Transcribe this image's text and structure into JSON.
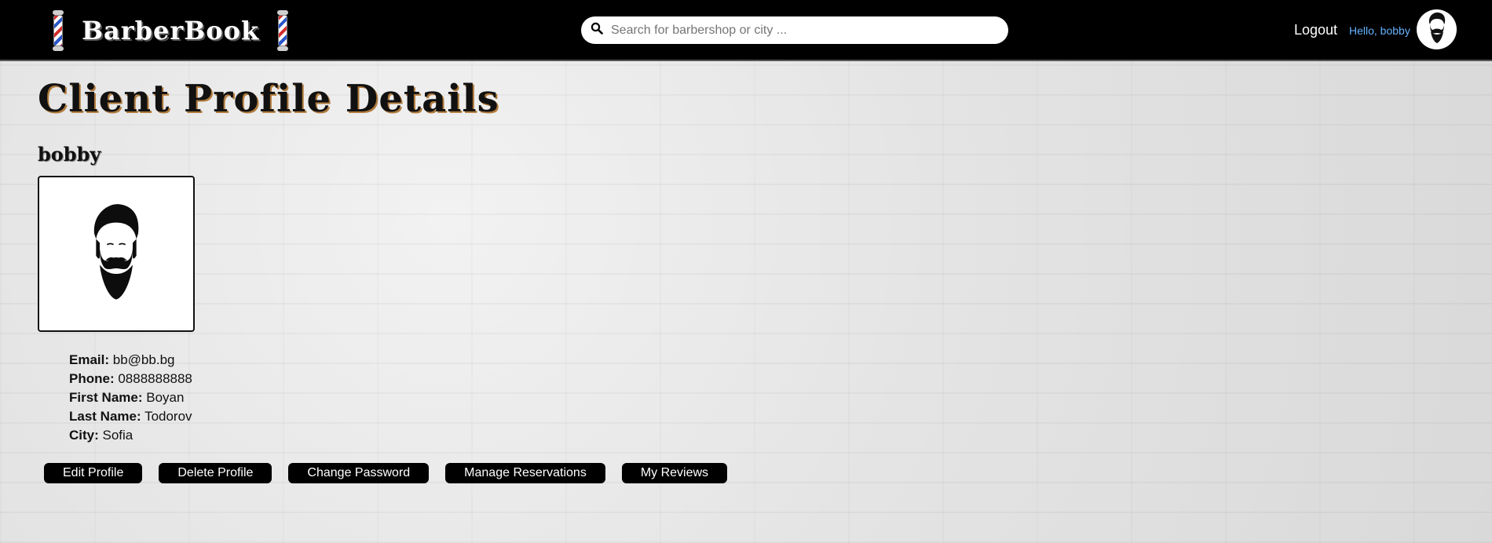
{
  "header": {
    "brand": "BarberBook",
    "search_placeholder": "Search for barbershop or city ...",
    "logout_label": "Logout",
    "greeting": "Hello, bobby",
    "icons": [
      "barber-pole-icon",
      "search-icon",
      "beard-avatar-icon"
    ]
  },
  "profile": {
    "page_title": "Client Profile Details",
    "username": "bobby",
    "fields": [
      {
        "label": "Email:",
        "value": "bb@bb.bg"
      },
      {
        "label": "Phone:",
        "value": "0888888888"
      },
      {
        "label": "First Name:",
        "value": "Boyan"
      },
      {
        "label": "Last Name:",
        "value": "Todorov"
      },
      {
        "label": "City:",
        "value": "Sofia"
      }
    ]
  },
  "actions": {
    "edit_profile": "Edit Profile",
    "delete_profile": "Delete Profile",
    "change_password": "Change Password",
    "manage_reservations": "Manage Reservations",
    "my_reviews": "My Reviews"
  },
  "colors": {
    "navbar_bg": "#000000",
    "greeting": "#66b3ff",
    "button_bg": "#000000",
    "page_bg": "#e6e6e6"
  }
}
